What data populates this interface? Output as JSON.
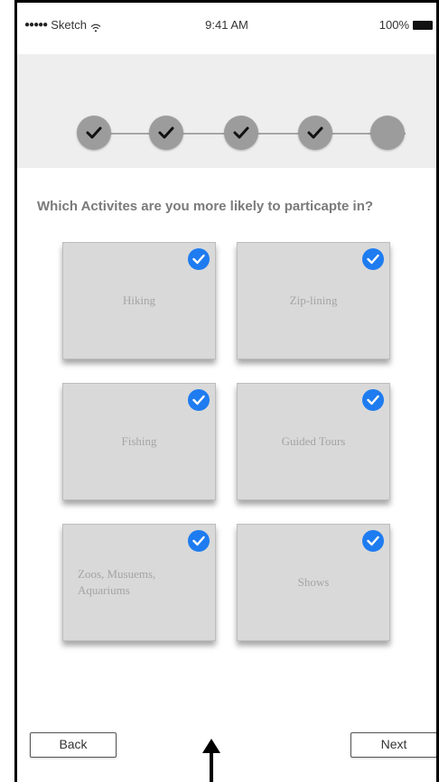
{
  "status_bar": {
    "carrier": "Sketch",
    "signal_icon": "signal-dots-icon",
    "wifi_icon": "wifi-icon",
    "time": "9:41 AM",
    "battery": "100%",
    "battery_icon": "battery-icon"
  },
  "progress": {
    "total_steps": 5,
    "completed_steps": 4
  },
  "question": "Which Activites are you more likely to particapte in?",
  "activities": [
    {
      "label": "Hiking",
      "selected": true
    },
    {
      "label": "Zip-lining",
      "selected": true
    },
    {
      "label": "Fishing",
      "selected": true
    },
    {
      "label": "Guided Tours",
      "selected": true
    },
    {
      "label": "Zoos, Musuems, Aquariums",
      "selected": true
    },
    {
      "label": "Shows",
      "selected": true
    }
  ],
  "buttons": {
    "back": "Back",
    "next": "Next"
  },
  "colors": {
    "accent": "#1e7cf0",
    "tile": "#d9d9d9",
    "step": "#9c9c9c"
  }
}
